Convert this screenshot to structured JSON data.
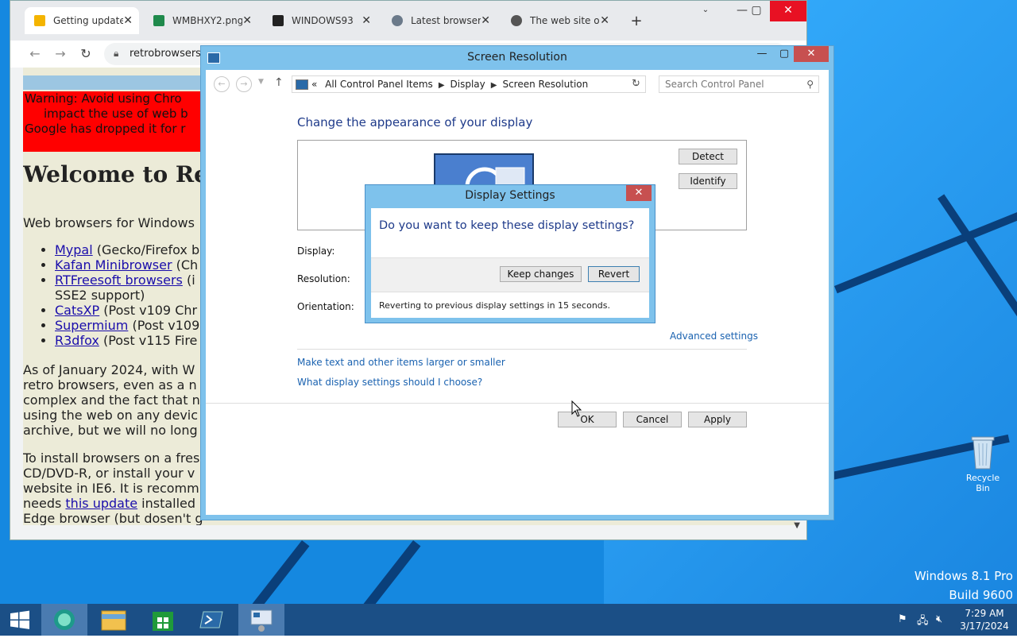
{
  "browser": {
    "tabs": [
      {
        "title": "Getting update",
        "icon_color": "#f4b400"
      },
      {
        "title": "WMBHXY2.png",
        "icon_color": "#1f8a4c"
      },
      {
        "title": "WINDOWS93",
        "icon_color": "#222222"
      },
      {
        "title": "Latest browsers",
        "icon_color": "#6b7a8a"
      },
      {
        "title": "The web site o",
        "icon_color": "#555555"
      }
    ],
    "url": "retrobrowsers.",
    "page": {
      "warning_lines": [
        "Warning: Avoid using Chro",
        "impact the use of web b",
        "Google has dropped it for r"
      ],
      "heading": "Welcome to Retr",
      "intro": "Web browsers for Windows",
      "list": [
        {
          "link": "Mypal",
          "rest": " (Gecko/Firefox b"
        },
        {
          "link": "Kafan Minibrowser",
          "rest": " (Ch"
        },
        {
          "link": "RTFreesoft browsers",
          "rest": " (i"
        },
        {
          "link": "",
          "rest": "SSE2 support)"
        },
        {
          "link": "CatsXP",
          "rest": " (Post v109 Chr"
        },
        {
          "link": "Supermium",
          "rest": " (Post v109"
        },
        {
          "link": "R3dfox",
          "rest": " (Post v115 Fire"
        }
      ],
      "para1": [
        "As of January 2024, with W",
        "retro browsers, even as a n",
        "complex and the fact that n",
        "using the web on any devic",
        "archive, but we will no long"
      ],
      "para2": [
        "To install browsers on a fres",
        "CD/DVD-R, or install your v",
        "website in IE6. It is recomm",
        "needs ",
        "installed",
        "Edge browser (but dosen't g"
      ],
      "update_link": "this update"
    }
  },
  "control_panel": {
    "title": "Screen Resolution",
    "breadcrumb": [
      "All Control Panel Items",
      "Display",
      "Screen Resolution"
    ],
    "breadcrumb_prefix": "«",
    "search_placeholder": "Search Control Panel",
    "heading": "Change the appearance of your display",
    "detect": "Detect",
    "identify": "Identify",
    "labels": {
      "display": "Display:",
      "resolution": "Resolution:",
      "orientation": "Orientation:"
    },
    "advanced": "Advanced settings",
    "link1": "Make text and other items larger or smaller",
    "link2": "What display settings should I choose?",
    "ok": "OK",
    "cancel": "Cancel",
    "apply": "Apply"
  },
  "dialog": {
    "title": "Display Settings",
    "question": "Do you want to keep these display settings?",
    "keep": "Keep changes",
    "revert": "Revert",
    "countdown": "Reverting to previous display settings in 15 seconds."
  },
  "desktop": {
    "recycle_bin": "Recycle Bin",
    "watermark_line1": "Windows 8.1 Pro",
    "watermark_line2": "Build 9600"
  },
  "taskbar": {
    "items": [
      "start-icon",
      "browser-icon",
      "file-explorer-icon",
      "store-icon",
      "powershell-icon",
      "control-panel-icon"
    ],
    "time": "7:29 AM",
    "date": "3/17/2024"
  }
}
